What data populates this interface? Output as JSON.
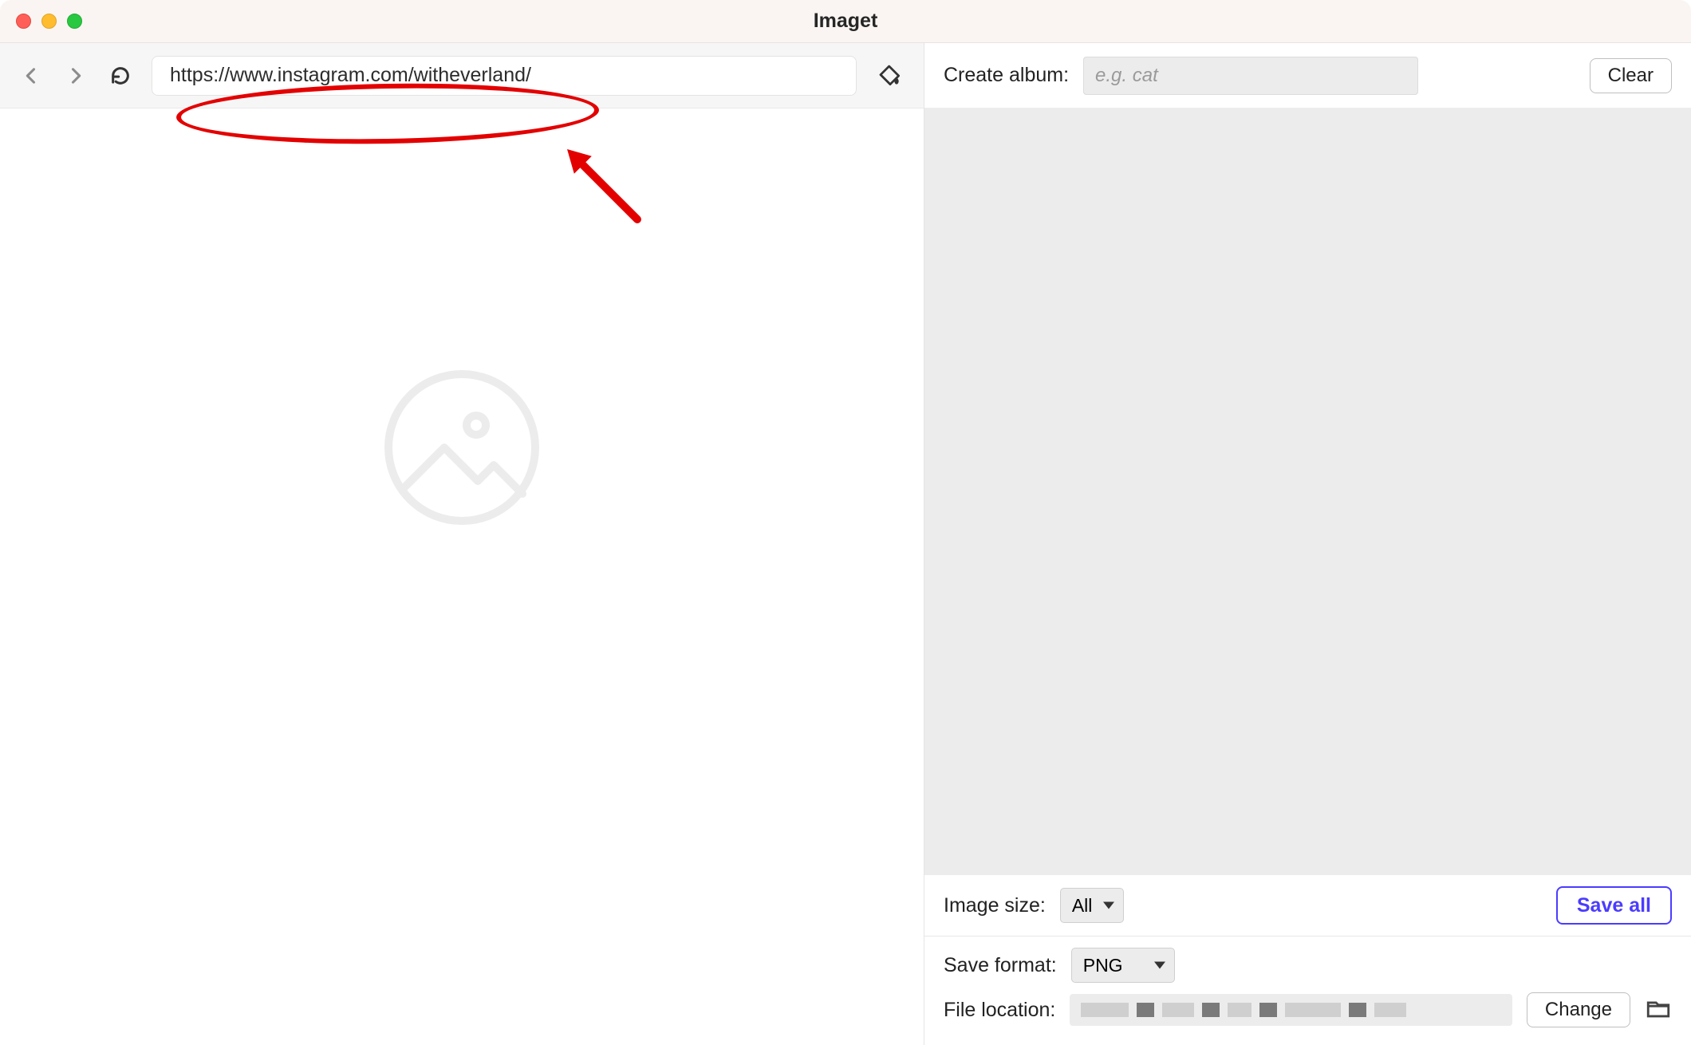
{
  "titlebar": {
    "app_title": "Imaget"
  },
  "left_toolbar": {
    "url_value": "https://www.instagram.com/witheverland/"
  },
  "right_topbar": {
    "create_album_label": "Create album:",
    "album_placeholder": "e.g. cat",
    "clear_label": "Clear"
  },
  "right_bottom": {
    "image_size_label": "Image size:",
    "image_size_value": "All",
    "save_all_label": "Save all",
    "save_format_label": "Save format:",
    "save_format_value": "PNG",
    "file_location_label": "File location:",
    "change_label": "Change"
  },
  "annotation": {
    "color": "#e30000"
  }
}
